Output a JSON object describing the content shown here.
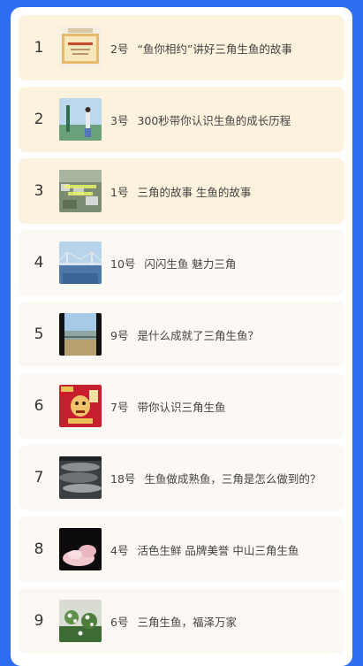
{
  "items": [
    {
      "rank": "1",
      "num": "2号",
      "title": "“鱼你相约”讲好三角生鱼的故事",
      "thumb": "certificate-thumbnail",
      "highlight": true
    },
    {
      "rank": "2",
      "num": "3号",
      "title": "300秒带你认识生鱼的成长历程",
      "thumb": "monument-photo-thumbnail",
      "highlight": true
    },
    {
      "rank": "3",
      "num": "1号",
      "title": "三角的故事 生鱼的故事",
      "thumb": "aerial-town-thumbnail",
      "highlight": true
    },
    {
      "rank": "4",
      "num": "10号",
      "title": "闪闪生鱼 魅力三角",
      "thumb": "bridge-photo-thumbnail",
      "highlight": false
    },
    {
      "rank": "5",
      "num": "9号",
      "title": "是什么成就了三角生鱼？",
      "thumb": "river-photo-thumbnail",
      "highlight": false
    },
    {
      "rank": "6",
      "num": "7号",
      "title": "带你认识三角生鱼",
      "thumb": "mascot-poster-thumbnail",
      "highlight": false
    },
    {
      "rank": "7",
      "num": "18号",
      "title": "生鱼做成熟鱼，三角是怎么做到的？",
      "thumb": "fish-photo-thumbnail",
      "highlight": false
    },
    {
      "rank": "8",
      "num": "4号",
      "title": "活色生鲜 品牌美誉 中山三角生鱼",
      "thumb": "fish-fillet-thumbnail",
      "highlight": false
    },
    {
      "rank": "9",
      "num": "6号",
      "title": "三角生鱼，福泽万家",
      "thumb": "flower-photo-thumbnail",
      "highlight": false
    }
  ],
  "colors": {
    "background": "#2f6df0",
    "highlight_row": "#fdf2dd",
    "normal_row": "#fcf9f4"
  }
}
